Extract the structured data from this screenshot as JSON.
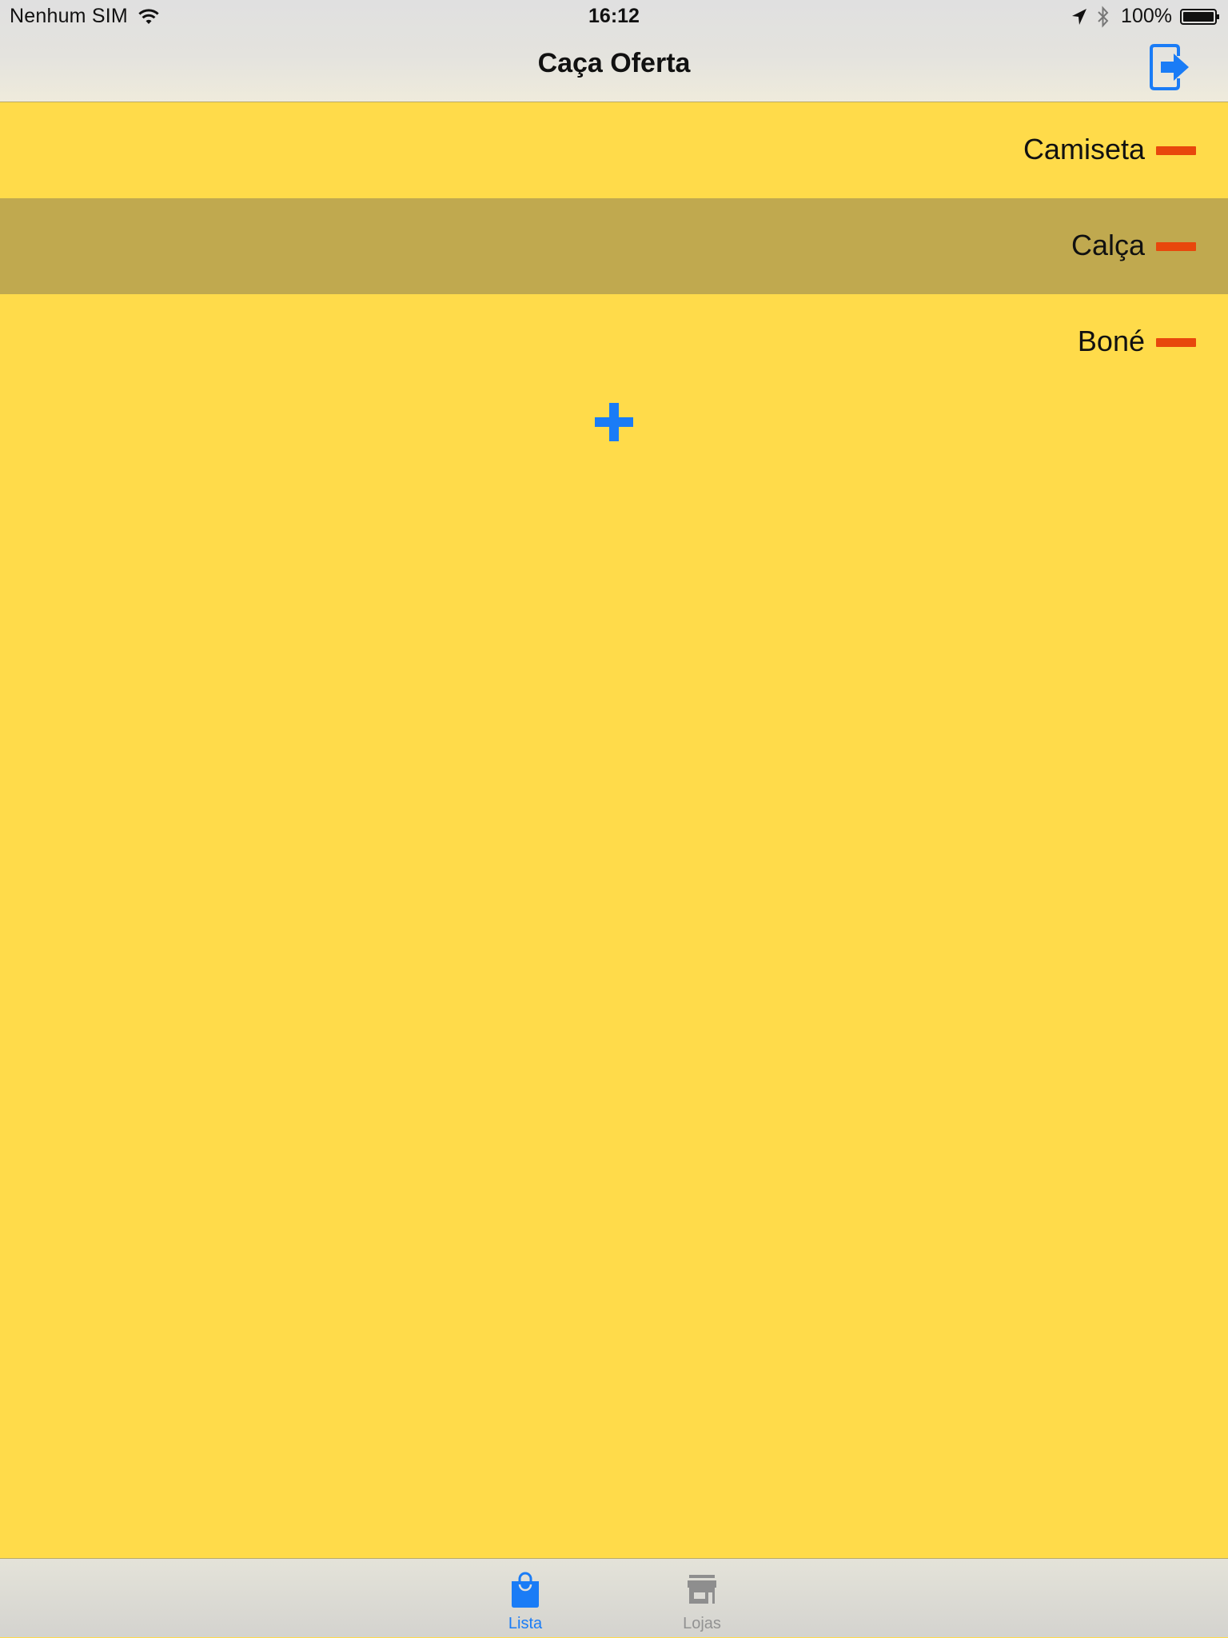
{
  "status_bar": {
    "carrier": "Nenhum SIM",
    "time": "16:12",
    "battery": "100%"
  },
  "nav": {
    "title": "Caça Oferta",
    "logout_icon": "logout-arrow-icon"
  },
  "list": {
    "items": [
      {
        "label": "Camiseta",
        "selected": false
      },
      {
        "label": "Calça",
        "selected": true
      },
      {
        "label": "Boné",
        "selected": false
      }
    ],
    "remove_icon": "minus-icon",
    "add_icon": "plus-icon"
  },
  "tab_bar": {
    "tabs": [
      {
        "label": "Lista",
        "icon": "shopping-bag-icon",
        "active": true
      },
      {
        "label": "Lojas",
        "icon": "store-icon",
        "active": false
      }
    ]
  },
  "colors": {
    "background": "#FFDB4A",
    "selected_row": "#C0A94F",
    "accent_blue": "#1A7CF6",
    "remove_red": "#E8470C"
  }
}
